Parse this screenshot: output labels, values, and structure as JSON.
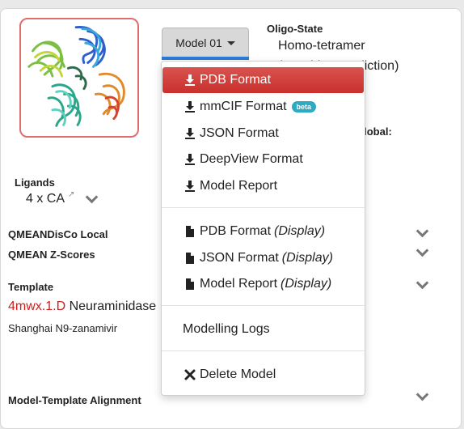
{
  "model_select": {
    "label": "Model 01"
  },
  "oligo": {
    "title": "Oligo-State",
    "value": "Homo-tetramer",
    "note": "(matching prediction)"
  },
  "global": {
    "label": "Global:"
  },
  "ligands": {
    "title": "Ligands",
    "value": "4 x CA"
  },
  "sections": {
    "qmean_local": "QMEANDisCo Local",
    "qmean_zscores": "QMEAN Z-Scores",
    "template": "Template",
    "alignment": "Model-Template Alignment"
  },
  "template": {
    "pdb_id": "4mwx.1.D",
    "name": "Neuraminidase",
    "description": "Shanghai N9-zanamivir"
  },
  "menu": {
    "download_pdb": "PDB Format",
    "download_mmcif": "mmCIF Format",
    "beta": "beta",
    "download_json": "JSON Format",
    "download_deepview": "DeepView Format",
    "download_report": "Model Report",
    "display_pdb": "PDB Format",
    "display_json": "JSON Format",
    "display_report": "Model Report",
    "display_suffix": "(Display)",
    "modelling_logs": "Modelling Logs",
    "delete_model": "Delete Model"
  },
  "colors": {
    "active": "#d9534f",
    "template_link": "#cc1f1f",
    "beta_badge": "#2ca9c3"
  },
  "icons": [
    "download-icon",
    "file-icon",
    "times-icon",
    "chevron-down-icon",
    "external-link-icon",
    "caret-down-icon"
  ]
}
